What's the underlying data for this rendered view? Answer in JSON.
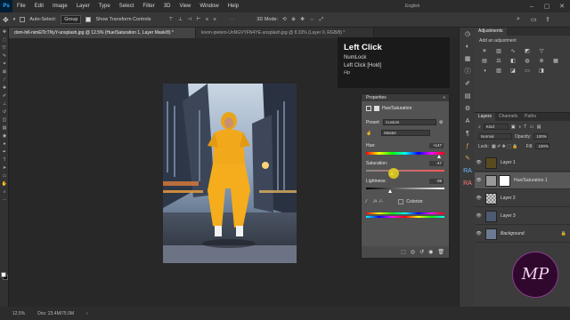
{
  "menubar": {
    "logo": "Ps",
    "items": [
      "File",
      "Edit",
      "Image",
      "Layer",
      "Type",
      "Select",
      "Filter",
      "3D",
      "View",
      "Window",
      "Help"
    ],
    "search_label": "English"
  },
  "options_bar": {
    "auto_select_label": "Auto-Select:",
    "auto_select_value": "Group",
    "transform_label": "Show Transform Controls",
    "mode_label": "3D Mode:"
  },
  "document_tabs": [
    {
      "label": "dom-hill-nimElTcTNyY-unsplash.jpg @ 12.5% (Hue/Saturation 1, Layer Mask/8) *",
      "active": true
    },
    {
      "label": "levon-pieters-UnNGVYFN4YE-unsplash.jpg @ 8.33% (Layer 0, RGB/8) *",
      "active": false
    }
  ],
  "tooltip": {
    "title": "Left Click",
    "line1": "NumLock",
    "line2": "Left Click [Hold]",
    "line3": "Hp"
  },
  "properties": {
    "tab": "Properties",
    "panel_title": "Hue/Saturation",
    "preset_label": "Preset:",
    "preset_value": "Custom",
    "channel_value": "Master",
    "hue_label": "Hue:",
    "hue_value": "+147",
    "saturation_label": "Saturation:",
    "saturation_value": "-47",
    "lightness_label": "Lightness:",
    "lightness_value": "-39",
    "colorize_label": "Colorize"
  },
  "adjustments": {
    "tab_adjustments": "Adjustments",
    "subtitle": "Add an adjustment"
  },
  "layers": {
    "tab_layers": "Layers",
    "tab_channels": "Channels",
    "tab_paths": "Paths",
    "kind_label": "Kind",
    "blend_mode": "Normal",
    "opacity_label": "Opacity:",
    "opacity_value": "100%",
    "lock_label": "Lock:",
    "fill_label": "Fill:",
    "fill_value": "100%",
    "items": [
      {
        "name": "Layer 1"
      },
      {
        "name": "Hue/Saturation 1"
      },
      {
        "name": "Layer 2"
      },
      {
        "name": "Layer 3"
      },
      {
        "name": "Background"
      }
    ]
  },
  "status": {
    "zoom": "12.5%",
    "doc": "Doc: 23.4M/75.0M"
  },
  "brand": {
    "text": "MP"
  }
}
